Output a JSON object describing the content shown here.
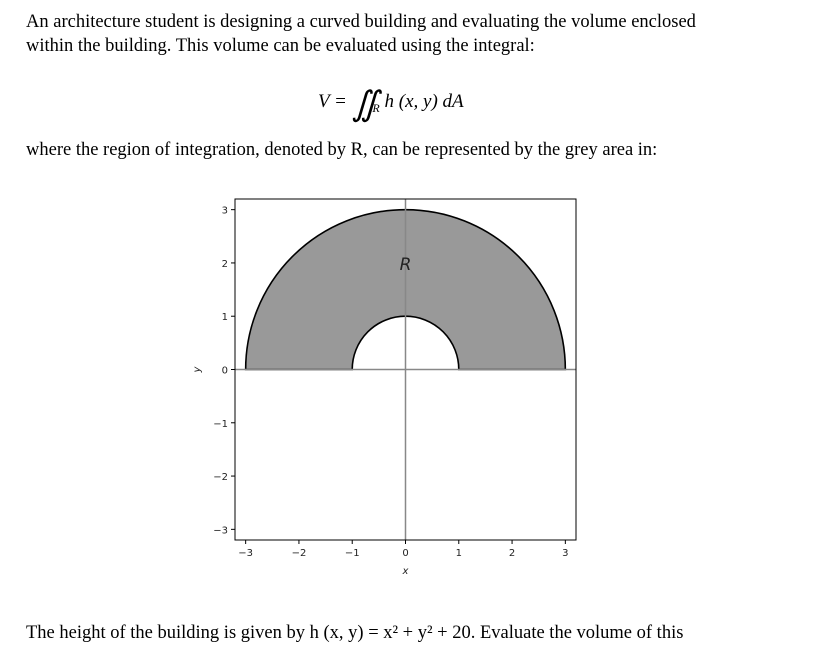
{
  "intro_line1": "An architecture student is designing a curved building and evaluating the volume enclosed",
  "intro_line2": "within the building. This volume can be evaluated using the integral:",
  "equation": {
    "lhs": "V =",
    "integral": "∬",
    "sub": "R",
    "integrand": "h (x, y)  dA"
  },
  "region_text": "where the region of integration, denoted by R, can be represented by the grey area in:",
  "height_text": "The height of the building is given by h (x, y) = x² + y² + 20. Evaluate the volume of this",
  "chart_data": {
    "type": "region",
    "xlabel": "x",
    "ylabel": "y",
    "xlim": [
      -3.2,
      3.2
    ],
    "ylim": [
      -3.2,
      3.2
    ],
    "xticks": [
      "−3",
      "−2",
      "−1",
      "0",
      "1",
      "2",
      "3"
    ],
    "yticks": [
      "3",
      "2",
      "1",
      "0",
      "−1",
      "−2",
      "−3"
    ],
    "region": {
      "label": "R",
      "inner_radius": 1,
      "outer_radius": 3,
      "theta_range_deg": [
        0,
        180
      ],
      "label_pos": [
        0,
        2
      ]
    },
    "fill_color": "#999999",
    "axis_line_color": "#888888",
    "grid": false
  }
}
